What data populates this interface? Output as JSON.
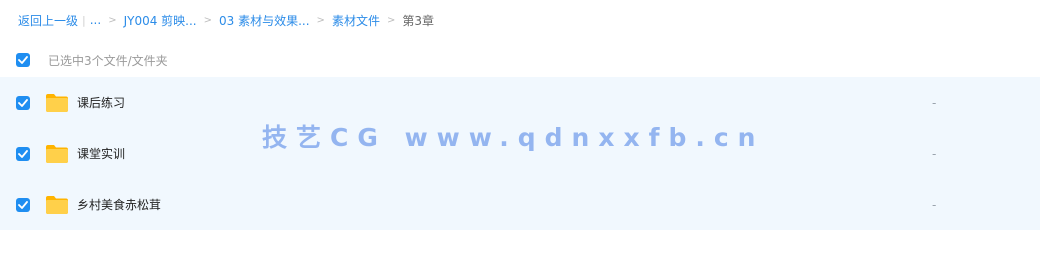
{
  "breadcrumb": {
    "back": "返回上一级",
    "ellipsis": "...",
    "items": [
      "JY004 剪映...",
      "03 素材与效果...",
      "素材文件"
    ],
    "current": "第3章"
  },
  "selection": {
    "label": "已选中3个文件/文件夹",
    "all_checked": true
  },
  "files": [
    {
      "name": "课后练习",
      "meta": "-",
      "checked": true
    },
    {
      "name": "课堂实训",
      "meta": "-",
      "checked": true
    },
    {
      "name": "乡村美食赤松茸",
      "meta": "-",
      "checked": true
    }
  ],
  "watermark": "技艺CG www.qdnxxfb.cn",
  "colors": {
    "accent": "#1f8ef1",
    "link": "#2c8ce8",
    "row_selected_bg": "#f1f8fe",
    "folder": "#ffc933"
  }
}
